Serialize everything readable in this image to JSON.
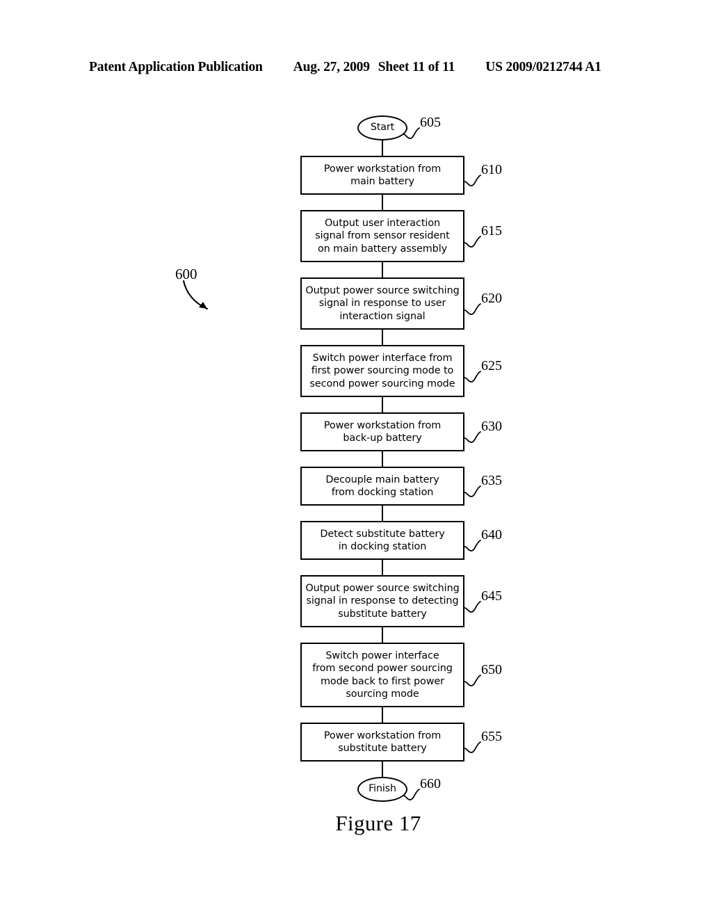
{
  "header": {
    "publication": "Patent Application Publication",
    "date": "Aug. 27, 2009",
    "sheet": "Sheet 11 of 11",
    "pub_number": "US 2009/0212744 A1"
  },
  "figure": {
    "caption": "Figure 17",
    "diagram_ref": "600"
  },
  "flowchart": {
    "type": "flowchart",
    "orientation": "top-to-bottom",
    "nodes": [
      {
        "id": "start",
        "ref": "605",
        "shape": "terminal",
        "lines": [
          "Start"
        ]
      },
      {
        "id": "step-610",
        "ref": "610",
        "shape": "process",
        "lines": [
          "Power workstation from",
          "main battery"
        ]
      },
      {
        "id": "step-615",
        "ref": "615",
        "shape": "process",
        "lines": [
          "Output user interaction",
          "signal from sensor resident",
          "on main battery assembly"
        ]
      },
      {
        "id": "step-620",
        "ref": "620",
        "shape": "process",
        "lines": [
          "Output power source switching",
          "signal in response to user",
          "interaction signal"
        ]
      },
      {
        "id": "step-625",
        "ref": "625",
        "shape": "process",
        "lines": [
          "Switch power interface from",
          "first power sourcing mode to",
          "second power sourcing mode"
        ]
      },
      {
        "id": "step-630",
        "ref": "630",
        "shape": "process",
        "lines": [
          "Power workstation from",
          "back-up battery"
        ]
      },
      {
        "id": "step-635",
        "ref": "635",
        "shape": "process",
        "lines": [
          "Decouple main battery",
          "from docking station"
        ]
      },
      {
        "id": "step-640",
        "ref": "640",
        "shape": "process",
        "lines": [
          "Detect substitute battery",
          "in docking station"
        ]
      },
      {
        "id": "step-645",
        "ref": "645",
        "shape": "process",
        "lines": [
          "Output power source switching",
          "signal in response to detecting",
          "substitute battery"
        ]
      },
      {
        "id": "step-650",
        "ref": "650",
        "shape": "process",
        "lines": [
          "Switch power interface",
          "from second power sourcing",
          "mode back to first power",
          "sourcing mode"
        ]
      },
      {
        "id": "step-655",
        "ref": "655",
        "shape": "process",
        "lines": [
          "Power workstation from",
          "substitute battery"
        ]
      },
      {
        "id": "finish",
        "ref": "660",
        "shape": "terminal",
        "lines": [
          "Finish"
        ]
      }
    ]
  },
  "colors": {
    "ink": "#000000",
    "page": "#ffffff"
  }
}
